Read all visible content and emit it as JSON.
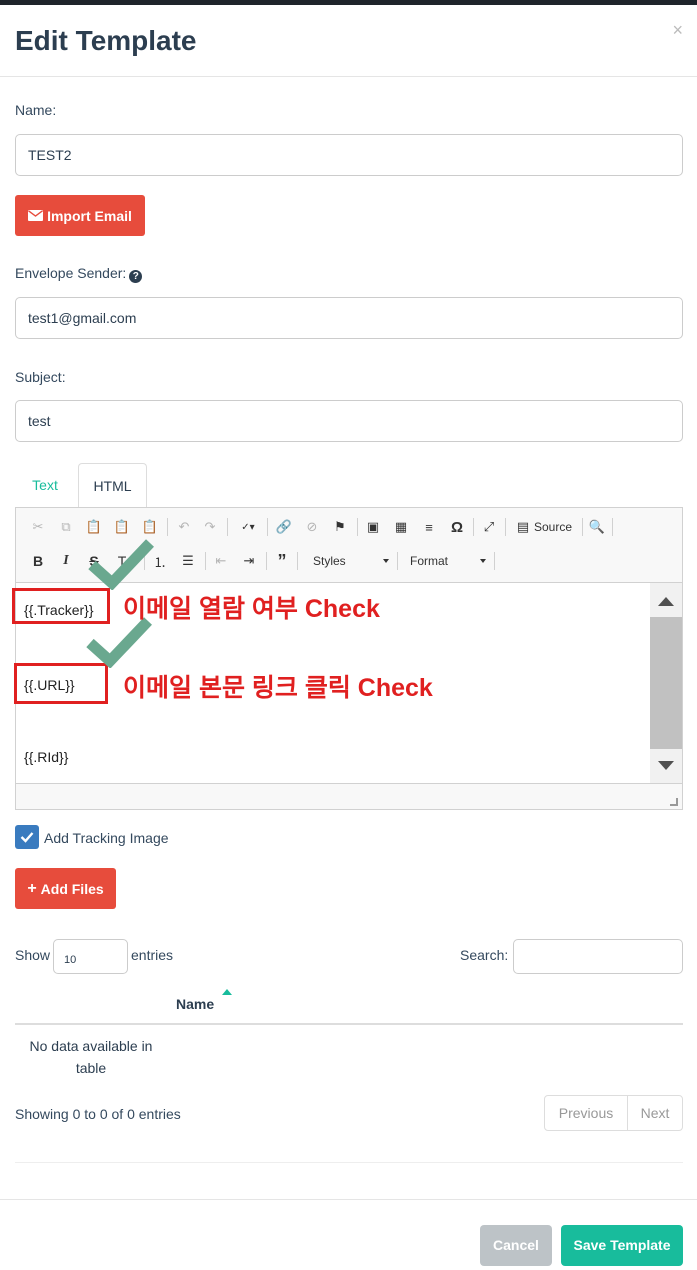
{
  "modal": {
    "title": "Edit Template",
    "close_symbol": "×"
  },
  "form": {
    "name_label": "Name:",
    "name_value": "TEST2",
    "import_email_label": "Import Email",
    "envelope_label": "Envelope Sender:",
    "envelope_help_icon": "question-circle-icon",
    "envelope_value": "test1@gmail.com",
    "subject_label": "Subject:",
    "subject_value": "test"
  },
  "tabs": [
    {
      "label": "Text",
      "active": false
    },
    {
      "label": "HTML",
      "active": true
    }
  ],
  "editor": {
    "toolbar": {
      "source_label": "Source",
      "styles_label": "Styles",
      "format_label": "Format"
    },
    "lines": [
      "{{.Tracker}}",
      "{{.URL}}",
      "{{.RId}}"
    ]
  },
  "annotations": {
    "tracker_note": "이메일 열람 여부 Check",
    "url_note": "이메일 본문 링크 클릭 Check",
    "color": "#e02020",
    "check_color": "#6aa88f"
  },
  "tracking": {
    "checkbox_label": "Add Tracking Image",
    "checked": true
  },
  "files": {
    "add_files_label": "Add Files",
    "show_label": "Show",
    "entries_value": "10",
    "entries_label": "entries",
    "search_label": "Search:",
    "column_name": "Name",
    "empty_message": "No data available in table",
    "info": "Showing 0 to 0 of 0 entries",
    "previous_label": "Previous",
    "next_label": "Next"
  },
  "footer": {
    "cancel_label": "Cancel",
    "save_label": "Save Template"
  },
  "colors": {
    "danger": "#e74c3c",
    "success": "#18bc9c",
    "primary_check": "#3a7bbf",
    "heading": "#2c3e50"
  }
}
